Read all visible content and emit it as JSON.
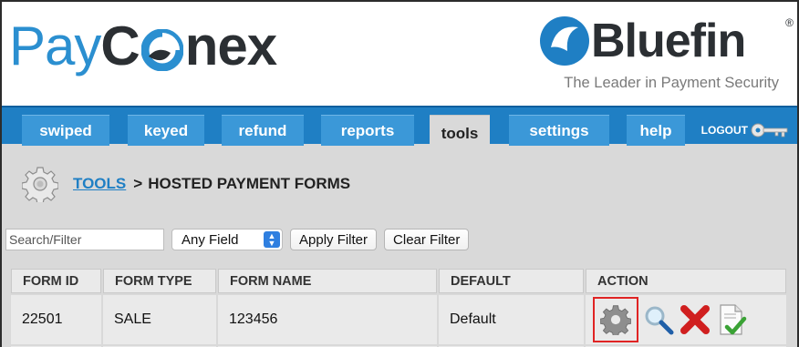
{
  "header": {
    "logo_left_prefix": "Pay",
    "logo_left_c": "C",
    "logo_left_suffix": "nex",
    "logo_right_word": "Bluefin",
    "logo_right_reg": "®",
    "logo_right_tagline": "The Leader in Payment Security"
  },
  "nav": {
    "tabs": [
      {
        "label": "swiped"
      },
      {
        "label": "keyed"
      },
      {
        "label": "refund"
      },
      {
        "label": "reports"
      },
      {
        "label": "tools"
      },
      {
        "label": "settings"
      },
      {
        "label": "help"
      }
    ],
    "active_tab": "tools",
    "logout_label": "LOGOUT"
  },
  "breadcrumb": {
    "link": "TOOLS",
    "separator": ">",
    "current": "HOSTED PAYMENT FORMS"
  },
  "filters": {
    "search_placeholder": "Search/Filter",
    "field_select_value": "Any Field",
    "apply_label": "Apply Filter",
    "clear_label": "Clear Filter"
  },
  "table": {
    "columns": [
      "FORM ID",
      "FORM TYPE",
      "FORM NAME",
      "DEFAULT",
      "ACTION"
    ],
    "rows": [
      {
        "form_id": "22501",
        "form_type": "SALE",
        "form_name": "123456",
        "default": "Default"
      }
    ]
  },
  "icons": {
    "breadcrumb": "gear-icon",
    "actions": [
      "gear-icon",
      "magnifier-icon",
      "delete-x-icon",
      "document-check-icon"
    ],
    "logout": "key-icon"
  },
  "colors": {
    "brand_blue": "#1f7fc4",
    "highlight_red": "#e02424"
  }
}
